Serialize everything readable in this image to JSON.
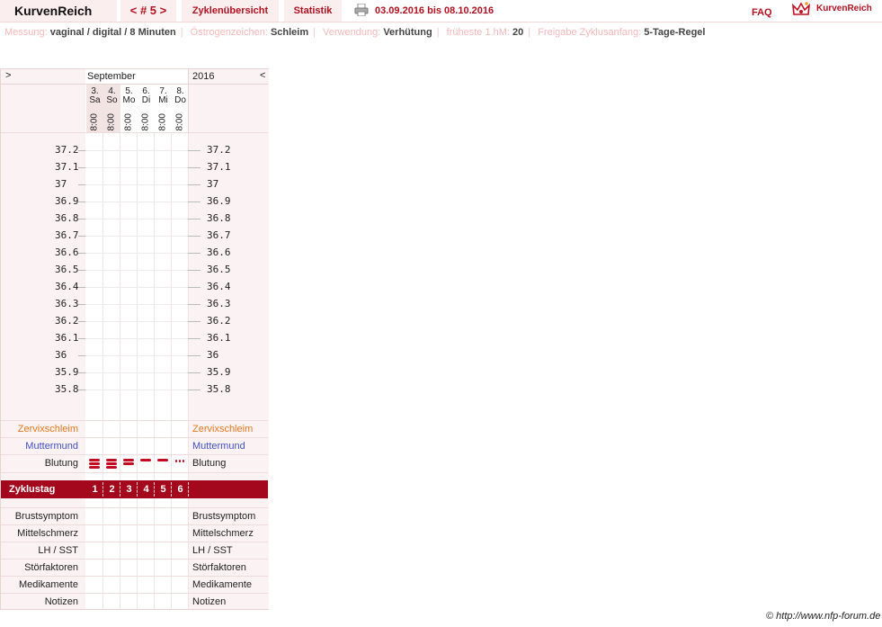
{
  "header": {
    "brand": "KurvenReich",
    "cycle_nav": "< # 5 >",
    "tabs": [
      "Zyklenübersicht",
      "Statistik"
    ],
    "date_range": "03.09.2016 bis 08.10.2016",
    "faq": "FAQ",
    "logo_text": "KurvenReich",
    "icons": {
      "print": "printer-icon",
      "logo": "crown-icon"
    },
    "accent": "#b01020"
  },
  "meta": {
    "messung_label": "Messung:",
    "messung": "vaginal / digital / 8 Minuten",
    "oestrogen_label": "Östrogenzeichen:",
    "oestrogen": "Schleim",
    "verwendung_label": "Verwendung:",
    "verwendung": "Verhütung",
    "hm_label": "früheste 1.hM:",
    "hm": "20",
    "freigabe_label": "Freigabe Zyklusanfang:",
    "freigabe": "5-Tage-Regel"
  },
  "chart": {
    "nav_left": ">",
    "nav_right": "<",
    "month": "September",
    "year": "2016",
    "days": [
      {
        "num": "3.",
        "wd": "Sa",
        "time": "8:00"
      },
      {
        "num": "4.",
        "wd": "So",
        "time": "8:00"
      },
      {
        "num": "5.",
        "wd": "Mo",
        "time": "8:00"
      },
      {
        "num": "6.",
        "wd": "Di",
        "time": "8:00"
      },
      {
        "num": "7.",
        "wd": "Mi",
        "time": "8:00"
      },
      {
        "num": "8.",
        "wd": "Do",
        "time": "8:00"
      }
    ],
    "temps": [
      "37.2",
      "37.1",
      "37",
      "36.9",
      "36.8",
      "36.7",
      "36.6",
      "36.5",
      "36.4",
      "36.3",
      "36.2",
      "36.1",
      "36",
      "35.9",
      "35.8"
    ],
    "zervix": "Zervixschleim",
    "muttermund": "Muttermund",
    "blutung": "Blutung",
    "zyklustag_label": "Zyklustag",
    "zyklustage": [
      "1",
      "2",
      "3",
      "4",
      "5",
      "6"
    ],
    "bleeding_intensity": [
      3,
      3,
      2,
      1,
      1,
      0.5
    ],
    "lower_rows": [
      "Brustsymptom",
      "Mittelschmerz",
      "LH / SST",
      "Störfaktoren",
      "Medikamente",
      "Notizen"
    ],
    "colors": {
      "zervix": "#e07820",
      "muttermund": "#4050c0",
      "zyklustag_bg": "#a3081c",
      "blutung": "#c40a20"
    }
  },
  "footer": {
    "copyright": "© http://www.nfp-forum.de"
  }
}
